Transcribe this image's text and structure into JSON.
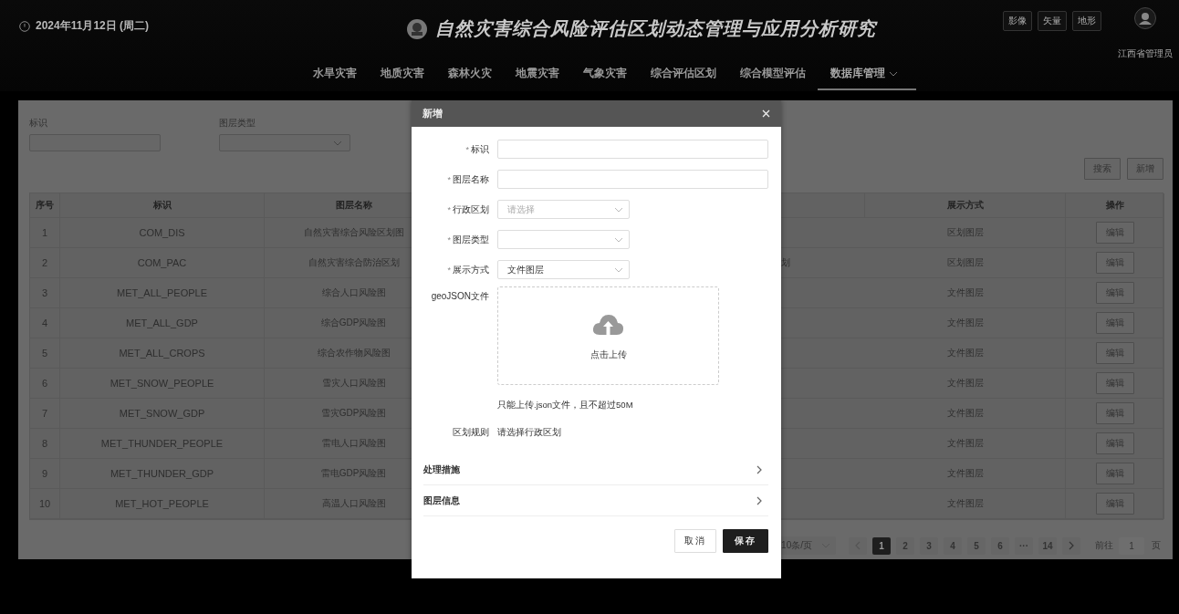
{
  "header": {
    "date": "2024年11月12日 (周二)",
    "title": "自然灾害综合风险评估区划动态管理与应用分析研究",
    "nav": [
      {
        "label": "水旱灾害",
        "selected": false
      },
      {
        "label": "地质灾害",
        "selected": false
      },
      {
        "label": "森林火灾",
        "selected": false
      },
      {
        "label": "地震灾害",
        "selected": false
      },
      {
        "label": "气象灾害",
        "selected": false
      },
      {
        "label": "综合评估区划",
        "selected": false
      },
      {
        "label": "综合模型评估",
        "selected": false
      },
      {
        "label": "数据库管理",
        "selected": true,
        "dropdown": true
      }
    ],
    "map_modes": [
      "影像",
      "矢量",
      "地形"
    ],
    "user": "江西省管理员"
  },
  "filters": [
    {
      "label": "标识",
      "kind": "text"
    },
    {
      "label": "图层类型",
      "kind": "select"
    }
  ],
  "actions": [
    "搜索",
    "新增"
  ],
  "table": {
    "columns": [
      "序号",
      "标识",
      "图层名称",
      "展示方式",
      "操作"
    ],
    "rows": [
      {
        "index": "1",
        "id": "COM_DIS",
        "name": "自然灾害综合风险区划图",
        "display": "区划图层",
        "action": "编辑"
      },
      {
        "index": "2",
        "id": "COM_PAC",
        "name": "自然灾害综合防治区划",
        "column_4": "划",
        "display": "区划图层",
        "action": "编辑"
      },
      {
        "index": "3",
        "id": "MET_ALL_PEOPLE",
        "name": "综合人口风险图",
        "display": "文件图层",
        "action": "编辑"
      },
      {
        "index": "4",
        "id": "MET_ALL_GDP",
        "name": "综合GDP风险图",
        "display": "文件图层",
        "action": "编辑"
      },
      {
        "index": "5",
        "id": "MET_ALL_CROPS",
        "name": "综合农作物风险图",
        "display": "文件图层",
        "action": "编辑"
      },
      {
        "index": "6",
        "id": "MET_SNOW_PEOPLE",
        "name": "雪灾人口风险图",
        "display": "文件图层",
        "action": "编辑"
      },
      {
        "index": "7",
        "id": "MET_SNOW_GDP",
        "name": "雪灾GDP风险图",
        "display": "文件图层",
        "action": "编辑"
      },
      {
        "index": "8",
        "id": "MET_THUNDER_PEOPLE",
        "name": "雷电人口风险图",
        "display": "文件图层",
        "action": "编辑"
      },
      {
        "index": "9",
        "id": "MET_THUNDER_GDP",
        "name": "雷电GDP风险图",
        "display": "文件图层",
        "action": "编辑"
      },
      {
        "index": "10",
        "id": "MET_HOT_PEOPLE",
        "name": "高温人口风险图",
        "display": "文件图层",
        "action": "编辑"
      }
    ]
  },
  "pagination": {
    "page_size": "10条/页",
    "pages": [
      {
        "label": "1",
        "selected": true
      },
      {
        "label": "2",
        "selected": false
      },
      {
        "label": "3",
        "selected": false
      },
      {
        "label": "4",
        "selected": false
      },
      {
        "label": "5",
        "selected": false
      },
      {
        "label": "6",
        "selected": false
      },
      {
        "label": "···",
        "selected": false
      },
      {
        "label": "14",
        "selected": false
      }
    ],
    "goto_label": "前往",
    "goto_value": "1",
    "goto_suffix": "页"
  },
  "dialog": {
    "title": "新增",
    "fields": [
      {
        "label": "标识",
        "required_mark": "*",
        "kind": "text"
      },
      {
        "label": "图层名称",
        "required_mark": "*",
        "kind": "text"
      },
      {
        "label": "行政区划",
        "required_mark": "*",
        "kind": "select",
        "placeholder": "请选择"
      },
      {
        "label": "图层类型",
        "required_mark": "*",
        "kind": "select"
      },
      {
        "label": "展示方式",
        "required_mark": "*",
        "kind": "select",
        "value": "文件图层"
      },
      {
        "label": "geoJSON文件",
        "kind": "upload",
        "upload_text": "点击上传",
        "tip": "只能上传.json文件，且不超过50M"
      },
      {
        "label": "区划规则",
        "kind": "static",
        "value": "请选择行政区划"
      }
    ],
    "sections": [
      {
        "label": "处理措施",
        "expanded": false
      },
      {
        "label": "图层信息",
        "expanded": false
      }
    ],
    "buttons": [
      {
        "label": "取消",
        "kind": "default"
      },
      {
        "label": "保存",
        "kind": "primary"
      }
    ]
  }
}
